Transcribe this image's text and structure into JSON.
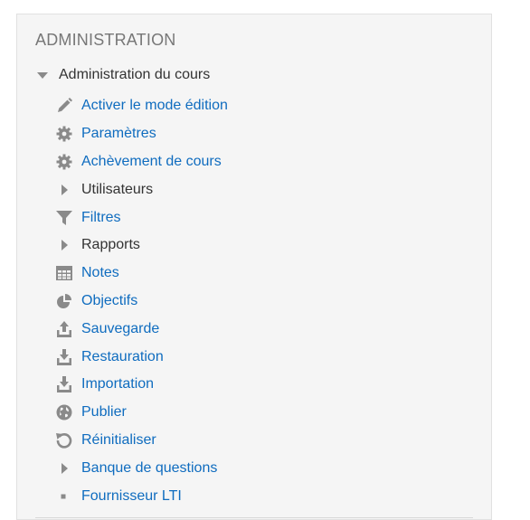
{
  "block": {
    "title": "ADMINISTRATION",
    "root_label": "Administration du cours",
    "items": [
      {
        "label": "Activer le mode édition",
        "icon": "pencil-icon",
        "link": true
      },
      {
        "label": "Paramètres",
        "icon": "gear-icon",
        "link": true
      },
      {
        "label": "Achèvement de cours",
        "icon": "gear-icon",
        "link": true
      },
      {
        "label": "Utilisateurs",
        "icon": "caret-right-icon",
        "link": false
      },
      {
        "label": "Filtres",
        "icon": "filter-icon",
        "link": true
      },
      {
        "label": "Rapports",
        "icon": "caret-right-icon",
        "link": false
      },
      {
        "label": "Notes",
        "icon": "table-icon",
        "link": true
      },
      {
        "label": "Objectifs",
        "icon": "pie-chart-icon",
        "link": true
      },
      {
        "label": "Sauvegarde",
        "icon": "upload-icon",
        "link": true
      },
      {
        "label": "Restauration",
        "icon": "download-icon",
        "link": true
      },
      {
        "label": "Importation",
        "icon": "download-icon",
        "link": true
      },
      {
        "label": "Publier",
        "icon": "globe-icon",
        "link": true
      },
      {
        "label": "Réinitialiser",
        "icon": "refresh-icon",
        "link": true
      },
      {
        "label": "Banque de questions",
        "icon": "caret-right-icon",
        "link": true
      },
      {
        "label": "Fournisseur LTI",
        "icon": "square-bullet-icon",
        "link": true
      }
    ]
  },
  "colors": {
    "link": "#0f6cbf",
    "text": "#333333",
    "icon": "#8a8a8a",
    "title": "#777777",
    "panel_bg": "#f5f5f5"
  }
}
